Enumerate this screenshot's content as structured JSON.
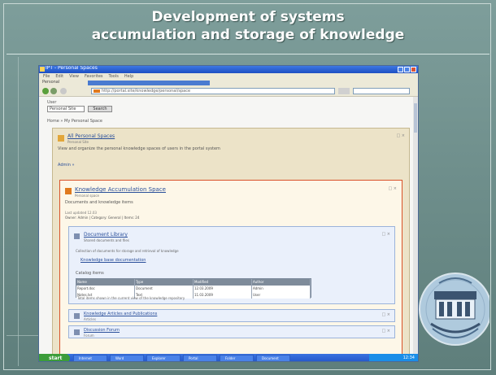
{
  "slide": {
    "title_line1": "Development of systems",
    "title_line2": "accumulation and storage of knowledge"
  },
  "colors": {
    "slide_bg": "#6f8f8c",
    "title_text": "#ffffff",
    "xp_titlebar": "#1d4fc3",
    "card_border": "#d9522a",
    "link": "#2a4f9a"
  },
  "browser": {
    "title": "IPT - Personal Spaces",
    "menu": [
      "File",
      "Edit",
      "View",
      "Favorites",
      "Tools",
      "Help"
    ],
    "tab_label": "Personal",
    "address": "http://portal.site/knowledge/personal/space"
  },
  "page": {
    "field_label": "User",
    "field_value": "Personal Site",
    "field_button": "Search",
    "breadcrumb": "Home » My Personal Space",
    "outer": {
      "title": "All Personal Spaces",
      "subtitle": "Personal Site",
      "description": "View and organize the personal knowledge spaces of users in the portal system",
      "link": "Admin »"
    },
    "inner": {
      "title": "Knowledge Accumulation Space",
      "subtitle": "Personal space",
      "description": "Documents and knowledge items",
      "meta1": "Last updated 12.03",
      "meta2": "Owner: Admin | Category: General | Items: 24"
    },
    "card": {
      "title": "Document Library",
      "subtitle": "Shared documents and files",
      "description": "Collection of documents for storage and retrieval of knowledge",
      "bullet": "Knowledge base documentation",
      "section": "Catalog items",
      "grid_header": [
        "Name",
        "Type",
        "Modified",
        "Author"
      ],
      "grid_rows": [
        [
          "Report.doc",
          "Document",
          "12.03.2009",
          "Admin"
        ],
        [
          "Notes.txt",
          "Text",
          "11.03.2009",
          "User"
        ]
      ],
      "footer": "Total items shown in the current view of the knowledge repository"
    },
    "rows": [
      {
        "title": "Knowledge Articles and Publications",
        "subtitle": "Articles"
      },
      {
        "title": "Discussion Forum",
        "subtitle": "Forum"
      }
    ],
    "corner_mark": "□ ×"
  },
  "taskbar": {
    "start": "start",
    "tasks": [
      "Internet",
      "Word",
      "Explorer",
      "Portal",
      "Folder",
      "Document"
    ],
    "clock": "12:34"
  }
}
